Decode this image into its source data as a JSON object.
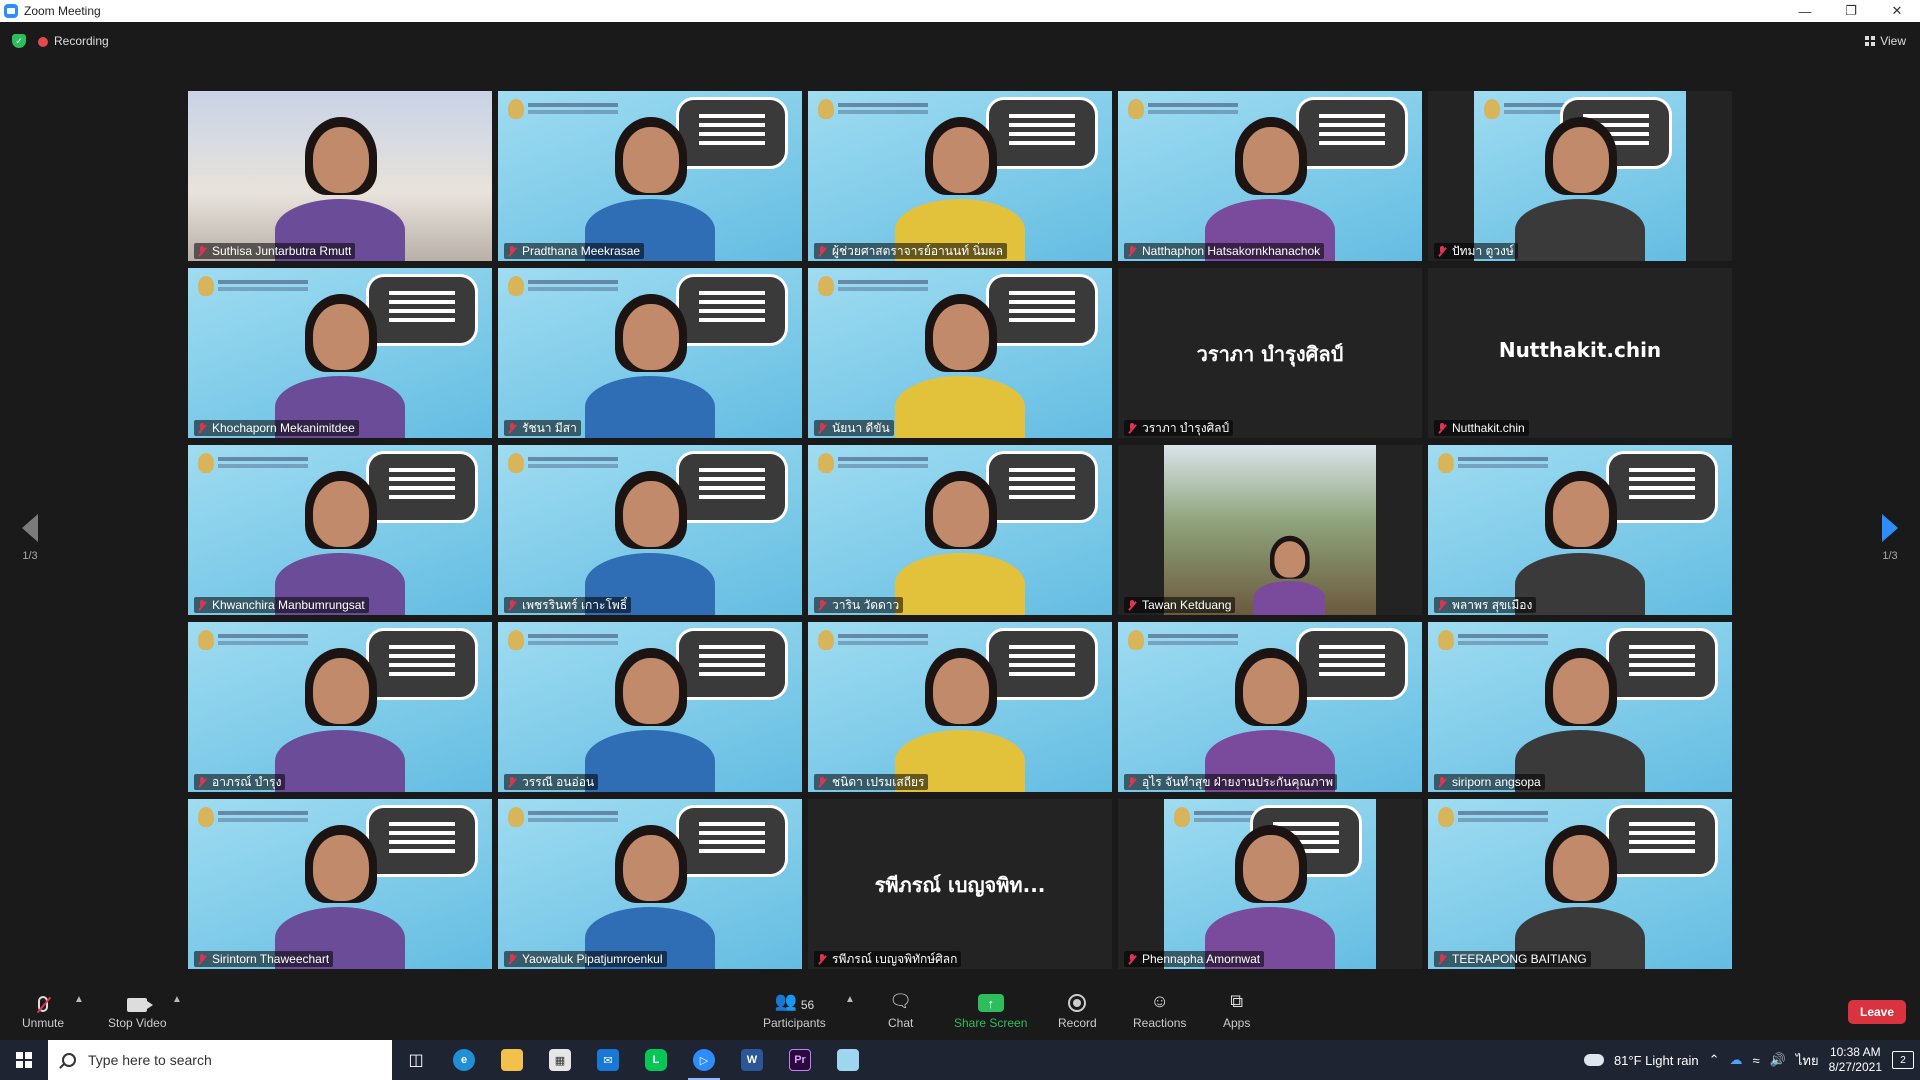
{
  "window": {
    "title": "Zoom Meeting"
  },
  "status": {
    "recording": "Recording",
    "view": "View"
  },
  "pager": {
    "left": "1/3",
    "right": "1/3"
  },
  "participants": [
    {
      "name": "Suthisa  Juntarbutra Rmutt",
      "kind": "room"
    },
    {
      "name": "Pradthana Meekrasae",
      "kind": "bg"
    },
    {
      "name": "ผู้ช่วยศาสตราจารย์อานนท์ นิ่มผล",
      "kind": "bg"
    },
    {
      "name": "Natthaphon Hatsakornkhanachok",
      "kind": "bg",
      "active": true
    },
    {
      "name": "ปัทมา ตูวงษ์",
      "kind": "narrow"
    },
    {
      "name": "Khochaporn Mekanimitdee",
      "kind": "bg"
    },
    {
      "name": "รัชนา มีสา",
      "kind": "bg"
    },
    {
      "name": "นัยนา ดีขัน",
      "kind": "bg"
    },
    {
      "name": "วราภา บำรุงศิลป์",
      "kind": "novideo",
      "display_name": "วราภา บำรุงศิลป์"
    },
    {
      "name": "Nutthakit.chin",
      "kind": "novideo",
      "display_name": "Nutthakit.chin"
    },
    {
      "name": "Khwanchira Manbumrungsat",
      "kind": "bg"
    },
    {
      "name": "เพชรรินทร์ เกาะโพธิ์",
      "kind": "bg"
    },
    {
      "name": "วาริน วัดดาว",
      "kind": "bg"
    },
    {
      "name": "Tawan Ketduang",
      "kind": "outdoor"
    },
    {
      "name": "พลาพร สุขเมือง",
      "kind": "bg"
    },
    {
      "name": "อาภรณ์ บำรุง",
      "kind": "bg"
    },
    {
      "name": "วรรณี อนอ่อน",
      "kind": "bg"
    },
    {
      "name": "ชนิดา เปรมเสถียร",
      "kind": "bg"
    },
    {
      "name": "อุไร จันทำสุข ฝ่ายงานประกันคุณภาพ",
      "kind": "bg"
    },
    {
      "name": "siriporn angsopa",
      "kind": "bg"
    },
    {
      "name": "Sirintorn Thaweechart",
      "kind": "bg"
    },
    {
      "name": "Yaowaluk Pipatjumroenkul",
      "kind": "bg"
    },
    {
      "name": "รพีภรณ์ เบญจพิทักษ์ศิลก",
      "kind": "novideo",
      "display_name": "รพีภรณ์ เบญจพิท..."
    },
    {
      "name": "Phennapha Amornwat",
      "kind": "narrow"
    },
    {
      "name": "TEERAPONG  BAITIANG",
      "kind": "bg"
    }
  ],
  "toolbar": {
    "unmute": "Unmute",
    "stop_video": "Stop Video",
    "participants": "Participants",
    "participants_count": "56",
    "chat": "Chat",
    "share_screen": "Share Screen",
    "record": "Record",
    "reactions": "Reactions",
    "apps": "Apps",
    "leave": "Leave"
  },
  "taskbar": {
    "search_placeholder": "Type here to search",
    "weather": "81°F  Light rain",
    "language": "ไทย",
    "time": "10:38 AM",
    "date": "8/27/2021",
    "notifications": "2"
  }
}
